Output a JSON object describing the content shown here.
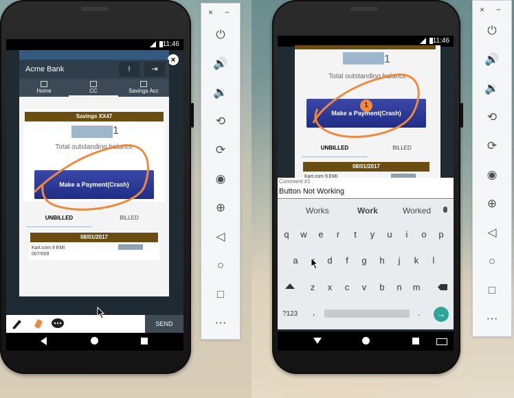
{
  "left_phone": {
    "status_time": "11:46",
    "app_title": "Acme Bank",
    "tabs": [
      {
        "label": "Home",
        "icon": "home-icon"
      },
      {
        "label": "CC",
        "icon": "card-icon"
      },
      {
        "label": "Savings Acc",
        "icon": "piggy-bank-icon"
      }
    ],
    "account_header": "Savings XX47",
    "masked_amount_digit": "1",
    "balance_label": "Total outstanding balance",
    "pay_button": "Make a Payment(Crash)",
    "subtabs": [
      "UNBILLED",
      "BILLED"
    ],
    "date_header": "08/01/2017",
    "transaction": {
      "line1": "Kart.com 9 EMI",
      "line2": "007/009"
    },
    "annotation_send": "SEND"
  },
  "right_phone": {
    "status_time": "11:46",
    "masked_amount_digit": "1",
    "balance_label": "Total outstanding balance",
    "pay_button": "Make a Payment(Crash)",
    "marker_number": "1",
    "subtabs": [
      "UNBILLED",
      "BILLED"
    ],
    "date_header": "08/01/2017",
    "transaction": {
      "line1": "Kart.com 9 EMI"
    },
    "comment_label": "Comment #1",
    "comment_value": "Button Not Working",
    "suggestions": [
      "Works",
      "Work",
      "Worked"
    ],
    "keyboard_rows": [
      [
        "q",
        "w",
        "e",
        "r",
        "t",
        "y",
        "u",
        "i",
        "o",
        "p"
      ],
      [
        "a",
        "s",
        "d",
        "f",
        "g",
        "h",
        "j",
        "k",
        "l"
      ],
      [
        "z",
        "x",
        "c",
        "v",
        "b",
        "n",
        "m"
      ]
    ],
    "key_symbols": "?123",
    "key_comma": ",",
    "key_period": "."
  },
  "emulator_panel": {
    "close": "×",
    "minimize": "−",
    "icons": [
      "power-icon",
      "volume-up-icon",
      "volume-down-icon",
      "rotate-left-icon",
      "rotate-right-icon",
      "camera-icon",
      "zoom-icon",
      "back-icon",
      "home-icon",
      "overview-icon",
      "more-icon"
    ]
  },
  "colors": {
    "gold": "#6b4e0f",
    "button_blue": "#2a3593",
    "appbar": "#2f3e4a",
    "scribble": "#f08a3a"
  }
}
